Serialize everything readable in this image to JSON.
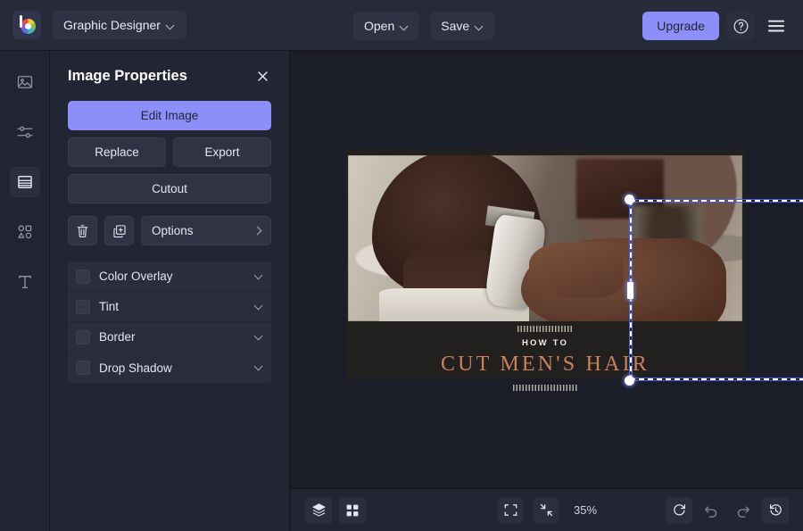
{
  "topbar": {
    "logo_icon": "befunky-logo-icon",
    "mode_label": "Graphic Designer",
    "open_label": "Open",
    "save_label": "Save",
    "upgrade_label": "Upgrade",
    "help_icon": "question-circle-icon",
    "menu_icon": "hamburger-menu-icon",
    "accent_color": "#8b8ff7"
  },
  "rail": {
    "items": [
      {
        "name": "image-tool",
        "icon": "image-icon",
        "active": false
      },
      {
        "name": "adjust-tool",
        "icon": "sliders-icon",
        "active": false
      },
      {
        "name": "layout-tool",
        "icon": "layout-icon",
        "active": true
      },
      {
        "name": "shapes-tool",
        "icon": "shapes-icon",
        "active": false
      },
      {
        "name": "text-tool",
        "icon": "text-icon",
        "active": false
      }
    ]
  },
  "panel": {
    "title": "Image Properties",
    "close_icon": "close-icon",
    "edit_image_label": "Edit Image",
    "replace_label": "Replace",
    "export_label": "Export",
    "cutout_label": "Cutout",
    "delete_icon": "trash-icon",
    "duplicate_icon": "duplicate-icon",
    "options_label": "Options",
    "options_chevron": "chevron-right-icon",
    "effects": [
      {
        "label": "Color Overlay",
        "checked": false
      },
      {
        "label": "Tint",
        "checked": false
      },
      {
        "label": "Border",
        "checked": false
      },
      {
        "label": "Drop Shadow",
        "checked": false
      }
    ]
  },
  "canvas": {
    "design": {
      "kicker": "HOW TO",
      "title": "CUT MEN'S HAIR",
      "title_color": "#c9805c",
      "kicker_color": "#f2efe9",
      "page_background": "#22201e"
    },
    "selection": {
      "rotate_handle_icon": "rotate-handle-icon"
    }
  },
  "bottombar": {
    "layers_icon": "layers-icon",
    "grid_icon": "grid-icon",
    "fit_icon": "fit-screen-icon",
    "shrink_icon": "zoom-to-fit-icon",
    "zoom_level": "35%",
    "reset_icon": "reset-rotate-icon",
    "undo_icon": "undo-icon",
    "redo_icon": "redo-icon",
    "history_icon": "history-icon"
  }
}
